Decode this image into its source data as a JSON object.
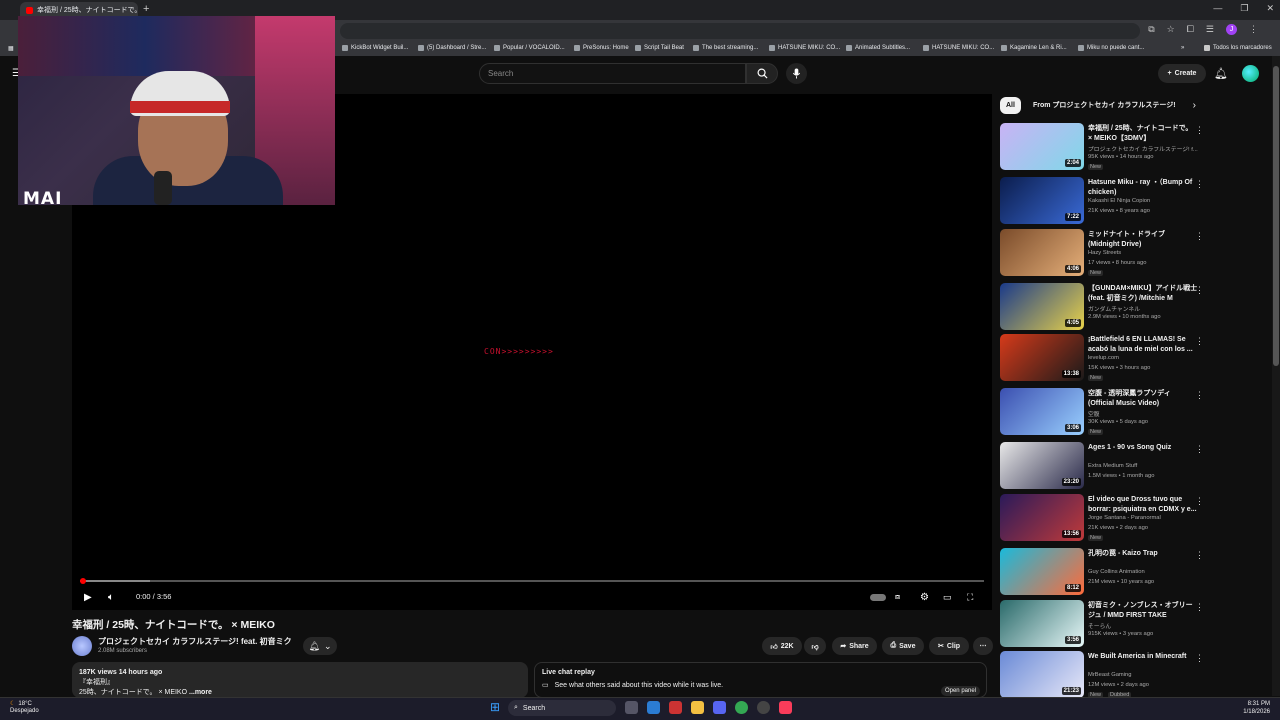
{
  "browser": {
    "tab_title": "幸福刑 / 25時、ナイトコードで。 ×",
    "bookmarks": [
      "KickBot Widget Buil...",
      "(5) Dashboard / Stre...",
      "Popular / VOCALOID...",
      "PreSonus: Home",
      "Script Tail Beat",
      "The best streaming...",
      "HATSUNE MIKU: CO...",
      "Animated Subtitles...",
      "HATSUNE MIKU: CO...",
      "Kagamine Len & Ri...",
      "Miku no puede cant...",
      "Todos los marcadores"
    ],
    "profile_initial": "J"
  },
  "youtube": {
    "search_placeholder": "Search",
    "create_label": "Create"
  },
  "webcam": {
    "label": "MAI"
  },
  "player": {
    "overlay_text": "CON>>>>>>>>>",
    "time": "0:00 / 3:56",
    "progress_fraction": 0.0
  },
  "video": {
    "title": "幸福刑 / 25時、ナイトコードで。 × MEIKO",
    "channel": "プロジェクトセカイ カラフルステージ! feat. 初音ミク",
    "subscribers": "2.08M subscribers",
    "likes": "22K",
    "share": "Share",
    "save": "Save",
    "clip": "Clip",
    "views_time": "187K views  14 hours ago",
    "desc_line1": "『幸福刑』",
    "desc_line2": "25時、ナイトコードで。 × MEIKO",
    "desc_more": "...more",
    "live_title": "Live chat replay",
    "live_desc": "See what others said about this video while it was live.",
    "open_panel": "Open panel"
  },
  "chips": {
    "all": "All",
    "from": "From プロジェクトセカイ カラフルステージ!"
  },
  "recommendations": [
    {
      "title": "幸福刑 / 25時、ナイトコードで。 × MEIKO【3DMV】",
      "channel": "プロジェクトセカイ カラフルステージ! f...",
      "meta": "95K views • 14 hours ago",
      "badge": "New",
      "duration": "2:04"
    },
    {
      "title": "Hatsune Miku - ray ・（Bump Of chicken)",
      "channel": "Kakashi El Ninja Copion",
      "meta": "21K views • 8 years ago",
      "badge": "",
      "duration": "7:22"
    },
    {
      "title": "ミッドナイト・ドライブ (Midnight Drive)",
      "channel": "Hazy Streets",
      "meta": "17 views • 8 hours ago",
      "badge": "New",
      "duration": "4:06"
    },
    {
      "title": "【GUNDAM×MIKU】アイドル戦士(feat. 初音ミク) /Mitchie M",
      "channel": "ガンダムチャンネル",
      "meta": "2.9M views • 10 months ago",
      "badge": "",
      "duration": "4:05"
    },
    {
      "title": "¡Battlefield 6 EN LLAMAS! Se acabó la luna de miel con los ...",
      "channel": "levelup.com",
      "meta": "15K views • 3 hours ago",
      "badge": "New",
      "duration": "13:38"
    },
    {
      "title": "空腹 - 透明深鳳ラプソディ (Official Music Video)",
      "channel": "空腹",
      "meta": "30K views • 5 days ago",
      "badge": "New",
      "duration": "3:06"
    },
    {
      "title": "Ages 1 - 90 vs Song Quiz",
      "channel": "Extra Medium Stuff",
      "meta": "1.5M views • 1 month ago",
      "badge": "",
      "duration": "23:20"
    },
    {
      "title": "El video que Dross tuvo que borrar: psiquiatra en CDMX y e...",
      "channel": "Jorge Santana - Paranormal",
      "meta": "21K views • 2 days ago",
      "badge": "New",
      "duration": "13:56"
    },
    {
      "title": "孔明の罠 - Kaizo Trap",
      "channel": "Guy Collins Animation",
      "meta": "21M views • 10 years ago",
      "badge": "",
      "duration": "8:12"
    },
    {
      "title": "初音ミク・ノンブレス・オブリージュ / MMD FIRST TAKE",
      "channel": "そーらん",
      "meta": "915K views • 3 years ago",
      "badge": "",
      "duration": "3:56"
    },
    {
      "title": "We Built America in Minecraft",
      "channel": "MrBeast Gaming",
      "meta": "12M views • 2 days ago",
      "badge": "New",
      "duration": "21:23",
      "badge2": "Dubbed"
    }
  ],
  "taskbar": {
    "temp": "18°C",
    "weather": "Despejado",
    "search": "Search",
    "time": "8:31 PM",
    "date": "1/18/2026"
  }
}
